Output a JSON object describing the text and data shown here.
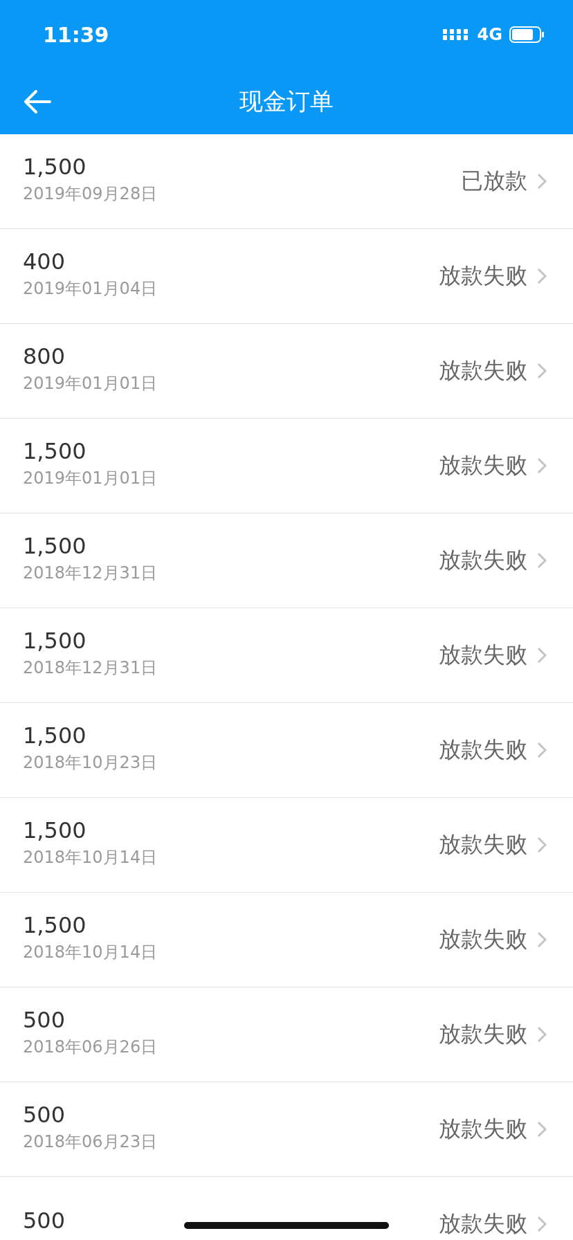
{
  "status_bar": {
    "time": "11:39",
    "network": "4G"
  },
  "nav": {
    "title": "现金订单"
  },
  "orders": [
    {
      "amount": "1,500",
      "date": "2019年09月28日",
      "status": "已放款"
    },
    {
      "amount": "400",
      "date": "2019年01月04日",
      "status": "放款失败"
    },
    {
      "amount": "800",
      "date": "2019年01月01日",
      "status": "放款失败"
    },
    {
      "amount": "1,500",
      "date": "2019年01月01日",
      "status": "放款失败"
    },
    {
      "amount": "1,500",
      "date": "2018年12月31日",
      "status": "放款失败"
    },
    {
      "amount": "1,500",
      "date": "2018年12月31日",
      "status": "放款失败"
    },
    {
      "amount": "1,500",
      "date": "2018年10月23日",
      "status": "放款失败"
    },
    {
      "amount": "1,500",
      "date": "2018年10月14日",
      "status": "放款失败"
    },
    {
      "amount": "1,500",
      "date": "2018年10月14日",
      "status": "放款失败"
    },
    {
      "amount": "500",
      "date": "2018年06月26日",
      "status": "放款失败"
    },
    {
      "amount": "500",
      "date": "2018年06月23日",
      "status": "放款失败"
    },
    {
      "amount": "500",
      "status": "放款失败"
    }
  ]
}
